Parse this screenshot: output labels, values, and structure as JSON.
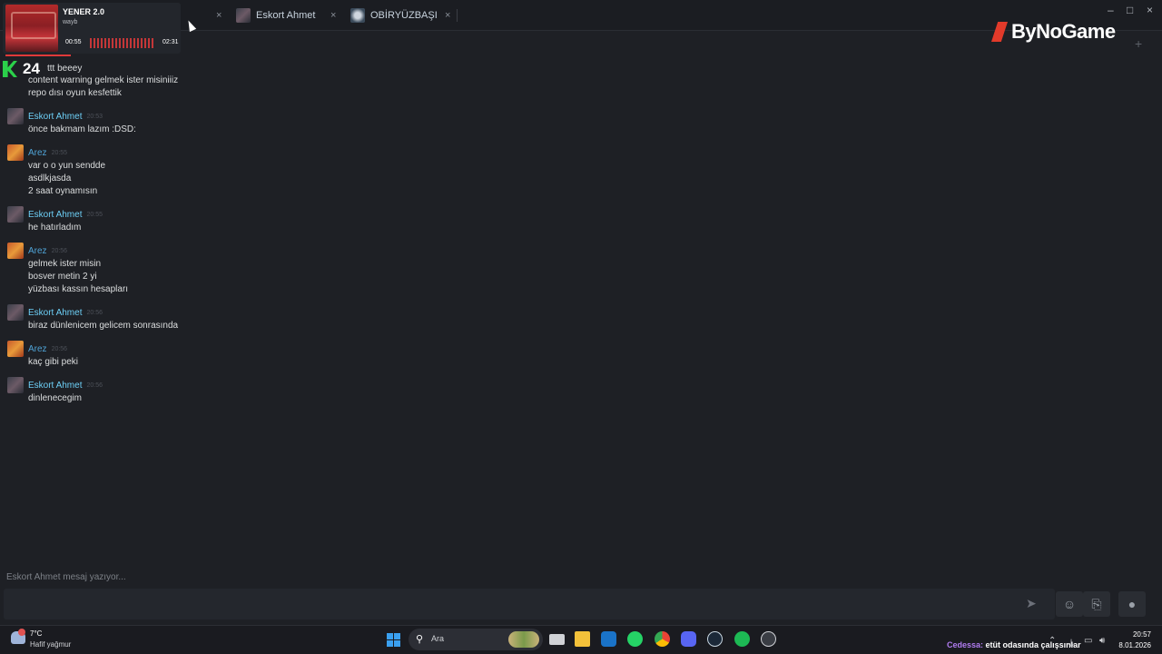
{
  "tabs": [
    {
      "label": "Eskort Ahmet",
      "active": true
    },
    {
      "label": "OBİRYÜZBAŞI",
      "active": false
    }
  ],
  "brand": {
    "logo_text": "ByNoGame"
  },
  "music_widget": {
    "title": "YENER 2.0",
    "artist": "wayb",
    "elapsed": "00:55",
    "duration": "02:31"
  },
  "overlay_badge": {
    "text": "24"
  },
  "messages": [
    {
      "lines": [
        "ttt beeey",
        "content warning gelmek ister misiniiiz",
        "repo dısı oyun kesfettik"
      ]
    },
    {
      "sender": "Eskort Ahmet",
      "time": "20:53",
      "lines": [
        "önce bakmam lazım :DSD:"
      ]
    },
    {
      "sender": "Arez",
      "time": "20:55",
      "lines": [
        "var o o yun sendde",
        "asdlkjasda",
        "2 saat oynamısın"
      ]
    },
    {
      "sender": "Eskort Ahmet",
      "time": "20:55",
      "lines": [
        "he hatırladım"
      ]
    },
    {
      "sender": "Arez",
      "time": "20:56",
      "lines": [
        "gelmek ister misin",
        "bosver metin 2 yi",
        "yüzbası kassın hesapları"
      ]
    },
    {
      "sender": "Eskort Ahmet",
      "time": "20:56",
      "lines": [
        "biraz dünlenicem gelicem sonrasında"
      ]
    },
    {
      "sender": "Arez",
      "time": "20:56",
      "lines": [
        "kaç gibi peki"
      ]
    },
    {
      "sender": "Eskort Ahmet",
      "time": "20:56",
      "lines": [
        "dinlenecegim"
      ]
    }
  ],
  "typing_indicator": "Eskort Ahmet mesaj yazıyor...",
  "taskbar": {
    "weather_temp": "7°C",
    "weather_desc": "Hafif yağmur",
    "search_placeholder": "Ara",
    "tray_who": "Cedessa:",
    "tray_status": "etüt odasında çalışsınlar",
    "time": "20:57",
    "date": "8.01.2026"
  },
  "colors": {
    "accent_name": "#6dcff6",
    "background": "#1e2025",
    "brand_red": "#e23a2a"
  }
}
